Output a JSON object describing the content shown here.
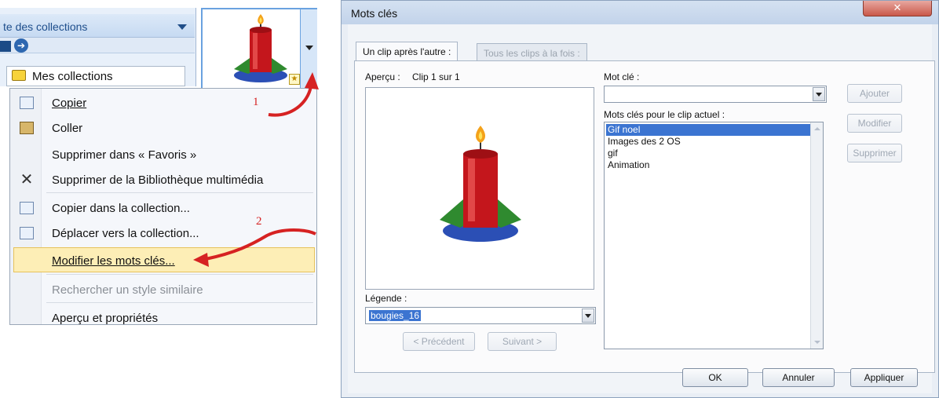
{
  "collections_pane": {
    "title": "te des collections",
    "nav_icon": "forward-arrow-icon",
    "tree_item_label": "Mes collections"
  },
  "context_menu": {
    "items": [
      {
        "label": "Copier",
        "icon": "copy-icon",
        "enabled": true
      },
      {
        "label": "Coller",
        "icon": "paste-icon",
        "enabled": true
      },
      {
        "label": "Supprimer dans « Favoris »",
        "icon": "",
        "enabled": true
      },
      {
        "label": "Supprimer de la Bibliothèque multimédia",
        "icon": "delete-x-icon",
        "enabled": true
      },
      {
        "label": "Copier dans la collection...",
        "icon": "copy-to-collection-icon",
        "enabled": true
      },
      {
        "label": "Déplacer vers la collection...",
        "icon": "move-to-collection-icon",
        "enabled": true
      },
      {
        "label": "Modifier les mots clés...",
        "icon": "",
        "enabled": true,
        "highlighted": true
      },
      {
        "label": "Rechercher un style similaire",
        "icon": "",
        "enabled": false
      },
      {
        "label": "Aperçu et propriétés",
        "icon": "",
        "enabled": true
      }
    ]
  },
  "annotations": {
    "step1": "1",
    "step2": "2",
    "color": "#d62222"
  },
  "dialog": {
    "title": "Mots clés",
    "tabs": [
      "Un clip après l'autre :",
      "Tous les clips à la fois :"
    ],
    "preview_label": "Aperçu :",
    "clip_counter": "Clip 1 sur 1",
    "keyword_label": "Mot clé :",
    "keyword_value": "",
    "add_button": "Ajouter",
    "current_keywords_label": "Mots clés pour le clip actuel :",
    "keywords": [
      "Gif noel",
      "Images des 2 OS",
      "gif",
      "Animation"
    ],
    "selected_keyword_index": 0,
    "modify_button": "Modifier",
    "delete_button": "Supprimer",
    "caption_label": "Légende :",
    "caption_value": "bougies_16",
    "prev_button": "< Précédent",
    "next_button": "Suivant >",
    "ok_button": "OK",
    "cancel_button": "Annuler",
    "apply_button": "Appliquer",
    "close_icon": "close-x-icon"
  }
}
